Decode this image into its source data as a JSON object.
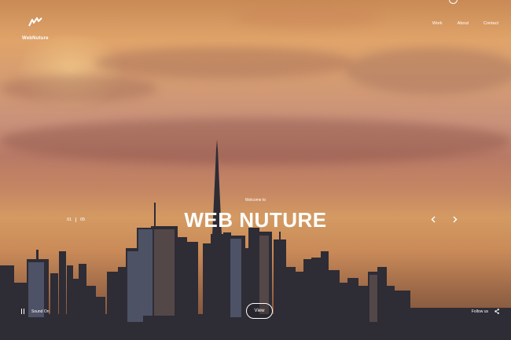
{
  "brand": {
    "name": "WebNuture",
    "logo_icon": "wave-logo-icon"
  },
  "nav": {
    "items": [
      "Work",
      "About",
      "Contact"
    ]
  },
  "hero": {
    "welcome": "Welcome to",
    "title": "WEB NUTURE",
    "view_label": "View"
  },
  "slider": {
    "current": "01",
    "total": "05",
    "prev_icon": "chevron-left-icon",
    "next_icon": "chevron-right-icon"
  },
  "footer": {
    "sound_label": "Sound On",
    "sound_icon": "sound-bars-icon",
    "follow_label": "Follow us",
    "share_icon": "share-icon"
  },
  "colors": {
    "text": "#ffffff",
    "sky_top": "#e0a46a",
    "skyline": "#2b2a33"
  }
}
